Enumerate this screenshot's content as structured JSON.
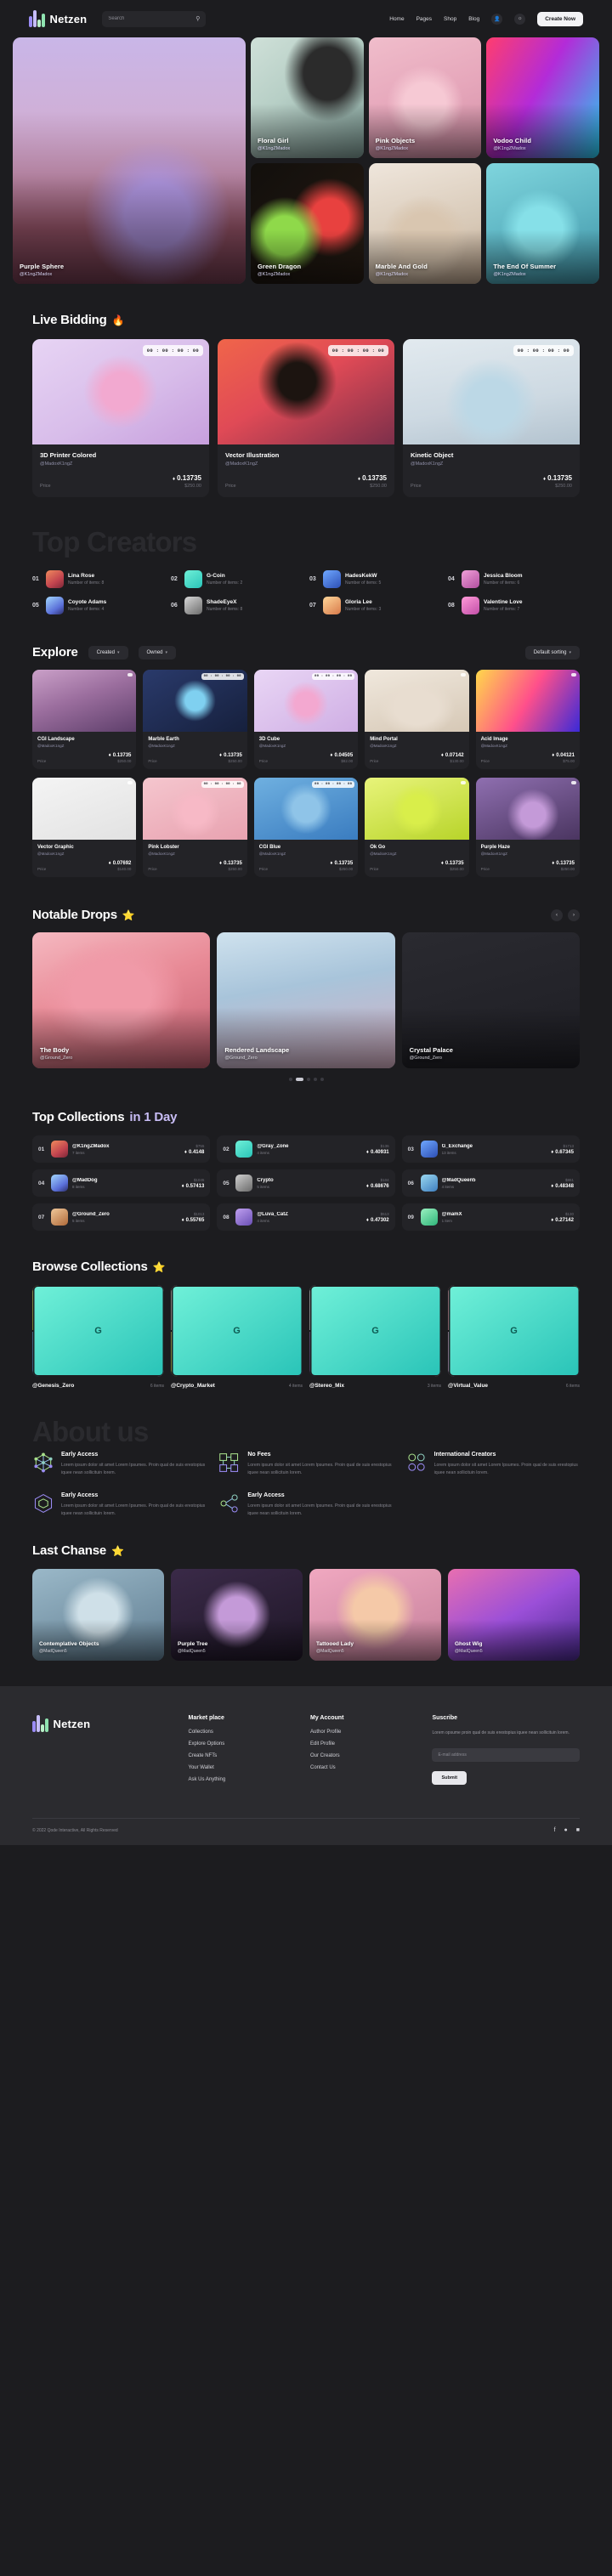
{
  "header": {
    "brand": "Netzen",
    "search_placeholder": "Search",
    "search_value": "",
    "nav": [
      "Home",
      "Pages",
      "Shop",
      "Blog"
    ],
    "cta_label": "Create Now"
  },
  "hero": {
    "main": {
      "title": "Purple Sphere",
      "user": "@K1ngZMadox"
    },
    "tiles": [
      {
        "title": "Floral Girl",
        "user": "@K1ngZMadox"
      },
      {
        "title": "Pink Objects",
        "user": "@K1ngZMadox"
      },
      {
        "title": "Vodoo Child",
        "user": "@K1ngZMadox"
      },
      {
        "title": "Green Dragon",
        "user": "@K1ngZMadox"
      },
      {
        "title": "Marble And Gold",
        "user": "@K1ngZMadox"
      },
      {
        "title": "The End Of Summer",
        "user": "@K1ngZMadox"
      }
    ]
  },
  "live_bidding": {
    "heading": "Live Bidding",
    "emoji": "🔥",
    "price_label": "Price",
    "cards": [
      {
        "title": "3D Printer Colored",
        "user": "@MadoxK1ngZ",
        "timer": "00 : 00 : 00 : 00",
        "eth": "0.13735",
        "usd": "$250.00"
      },
      {
        "title": "Vector Illustration",
        "user": "@MadoxK1ngZ",
        "timer": "00 : 00 : 00 : 00",
        "eth": "0.13735",
        "usd": "$250.00"
      },
      {
        "title": "Kinetic Object",
        "user": "@MadoxK1ngZ",
        "timer": "00 : 00 : 00 : 00",
        "eth": "0.13735",
        "usd": "$250.00"
      }
    ]
  },
  "top_creators": {
    "heading": "Top Creators",
    "items_label": "Number of items:",
    "list": [
      {
        "rank": "01",
        "name": "Lina Rose",
        "items": "Number of items: 8"
      },
      {
        "rank": "02",
        "name": "G-Coin",
        "items": "Number of items: 2"
      },
      {
        "rank": "03",
        "name": "HadesKekW",
        "items": "Number of items: 5"
      },
      {
        "rank": "04",
        "name": "Jessica Bloom",
        "items": "Number of items: 6"
      },
      {
        "rank": "05",
        "name": "Coyote Adams",
        "items": "Number of items: 4"
      },
      {
        "rank": "06",
        "name": "ShadeEyeX",
        "items": "Number of items: 8"
      },
      {
        "rank": "07",
        "name": "Gloria Lee",
        "items": "Number of items: 3"
      },
      {
        "rank": "08",
        "name": "Valentine Love",
        "items": "Number of items: 7"
      }
    ]
  },
  "explore": {
    "heading": "Explore",
    "filters": [
      "Created",
      "Owned"
    ],
    "sorting": "Default sorting",
    "price_label": "Price",
    "cards": [
      {
        "title": "CGI Landscape",
        "user": "@MadoxK1ngZ",
        "timer": "",
        "eth": "0.13735",
        "usd": "$250.00"
      },
      {
        "title": "Marble Earth",
        "user": "@MadoxK1ngZ",
        "timer": "00 : 00 : 00 : 00",
        "eth": "0.13735",
        "usd": "$250.00"
      },
      {
        "title": "3D Cube",
        "user": "@MadoxK1ngZ",
        "timer": "00 : 00 : 00 : 00",
        "eth": "0.04505",
        "usd": "$82.00"
      },
      {
        "title": "Mind Portal",
        "user": "@MadoxK1ngZ",
        "timer": "",
        "eth": "0.07142",
        "usd": "$130.00"
      },
      {
        "title": "Acid Image",
        "user": "@MadoxK1ngZ",
        "timer": "",
        "eth": "0.04121",
        "usd": "$75.00"
      },
      {
        "title": "Vector Graphic",
        "user": "@MadoxK1ngZ",
        "timer": "",
        "eth": "0.07692",
        "usd": "$140.00"
      },
      {
        "title": "Pink Lobster",
        "user": "@MadoxK1ngZ",
        "timer": "00 : 00 : 00 : 00",
        "eth": "0.13735",
        "usd": "$250.00"
      },
      {
        "title": "CGI Blue",
        "user": "@MadoxK1ngZ",
        "timer": "00 : 00 : 00 : 00",
        "eth": "0.13735",
        "usd": "$250.00"
      },
      {
        "title": "Ok Go",
        "user": "@MadoxK1ngZ",
        "timer": "",
        "eth": "0.13735",
        "usd": "$250.00"
      },
      {
        "title": "Purple Haze",
        "user": "@MadoxK1ngZ",
        "timer": "",
        "eth": "0.13735",
        "usd": "$250.00"
      }
    ]
  },
  "notable_drops": {
    "heading": "Notable Drops",
    "emoji": "⭐",
    "prev": "‹",
    "next": "›",
    "cards": [
      {
        "title": "The Body",
        "user": "@Ground_Zero"
      },
      {
        "title": "Rendered Landscape",
        "user": "@Ground_Zero"
      },
      {
        "title": "Crystal Palace",
        "user": "@Ground_Zero"
      }
    ],
    "dots": 5,
    "active_dot": 1
  },
  "top_collections": {
    "heading": "Top Collections",
    "highlight": "in 1 Day",
    "list": [
      {
        "rank": "01",
        "name": "@K1ngZMadox",
        "items": "7 items",
        "usd": "$755",
        "eth": "0.4148"
      },
      {
        "rank": "02",
        "name": "@Gray_Zone",
        "items": "4 items",
        "usd": "$136",
        "eth": "0.40931"
      },
      {
        "rank": "03",
        "name": "G_Exchange",
        "items": "13 items",
        "usd": "$1713",
        "eth": "0.67345"
      },
      {
        "rank": "04",
        "name": "@MadDog",
        "items": "8 items",
        "usd": "$1045",
        "eth": "0.57413"
      },
      {
        "rank": "05",
        "name": "Crypto",
        "items": "5 items",
        "usd": "$104",
        "eth": "0.68676"
      },
      {
        "rank": "06",
        "name": "@MadQueen5",
        "items": "4 items",
        "usd": "$861",
        "eth": "0.48348"
      },
      {
        "rank": "07",
        "name": "@Ground_Zero",
        "items": "5 items",
        "usd": "$1013",
        "eth": "0.55765"
      },
      {
        "rank": "08",
        "name": "@Luva_CatZ",
        "items": "4 items",
        "usd": "$513",
        "eth": "0.47302"
      },
      {
        "rank": "09",
        "name": "@mamX",
        "items": "1 item",
        "usd": "$130",
        "eth": "0.27142"
      }
    ]
  },
  "browse_collections": {
    "heading": "Browse Collections",
    "emoji": "⭐",
    "badge_letter": "G",
    "list": [
      {
        "name": "@Genesis_Zero",
        "items": "6 items"
      },
      {
        "name": "@Crypto_Market",
        "items": "4 items"
      },
      {
        "name": "@Stereo_Mix",
        "items": "3 items"
      },
      {
        "name": "@Virtual_Value",
        "items": "6 items"
      }
    ]
  },
  "about": {
    "heading": "About us",
    "features": [
      {
        "title": "Early Access",
        "desc": "Lorem ipsum dolor sit amet Lorem Ipsumes. Proin qual de suis erestopius iquee nean sollicituin lorem.",
        "icon": "network-icon"
      },
      {
        "title": "No Fees",
        "desc": "Lorem ipsum dolor sit amet Lorem Ipsumes. Proin qual de suis erestopius iquee nean sollicituin lorem.",
        "icon": "blocks-icon"
      },
      {
        "title": "International Creators",
        "desc": "Lorem ipsum dolor sit amet Lorem Ipsumes. Proin qual de suis erestopius iquee nean sollicituin lorem.",
        "icon": "cluster-icon"
      },
      {
        "title": "Early Access",
        "desc": "Lorem ipsum dolor sit amet Lorem Ipsumes. Proin qual de suis erestopius iquee nean sollicituin lorem.",
        "icon": "hexagon-icon"
      },
      {
        "title": "Early Access",
        "desc": "Lorem ipsum dolor sit amet Lorem Ipsumes. Proin qual de suis erestopius iquee nean sollicituin lorem.",
        "icon": "node-icon"
      }
    ]
  },
  "last_chance": {
    "heading": "Last Chanse",
    "emoji": "⭐",
    "cards": [
      {
        "title": "Contemplative Objects",
        "user": "@MadQueen5"
      },
      {
        "title": "Purple Tree",
        "user": "@MadQueen5"
      },
      {
        "title": "Tattooed Lady",
        "user": "@MadQueen5"
      },
      {
        "title": "Ghost Wig",
        "user": "@MadQueen5"
      }
    ]
  },
  "footer": {
    "brand": "Netzen",
    "columns": [
      {
        "title": "Market place",
        "links": [
          "Collections",
          "Explore Options",
          "Create NFTs",
          "Your Wallet",
          "Ask Us Anything"
        ]
      },
      {
        "title": "My Account",
        "links": [
          "Author Profile",
          "Edit Profile",
          "Our Creators",
          "Contact Us"
        ]
      }
    ],
    "subscribe": {
      "title": "Suscribe",
      "desc": "Lorem opsume proin qual de suis erestopius iquee nean sollicituin lorem.",
      "placeholder": "E-mail address",
      "value": "",
      "button": "Submit"
    },
    "copyright": "© 2022 Qode Interactive, All Rights Reserved",
    "socials": [
      "f",
      "●",
      "■"
    ]
  }
}
